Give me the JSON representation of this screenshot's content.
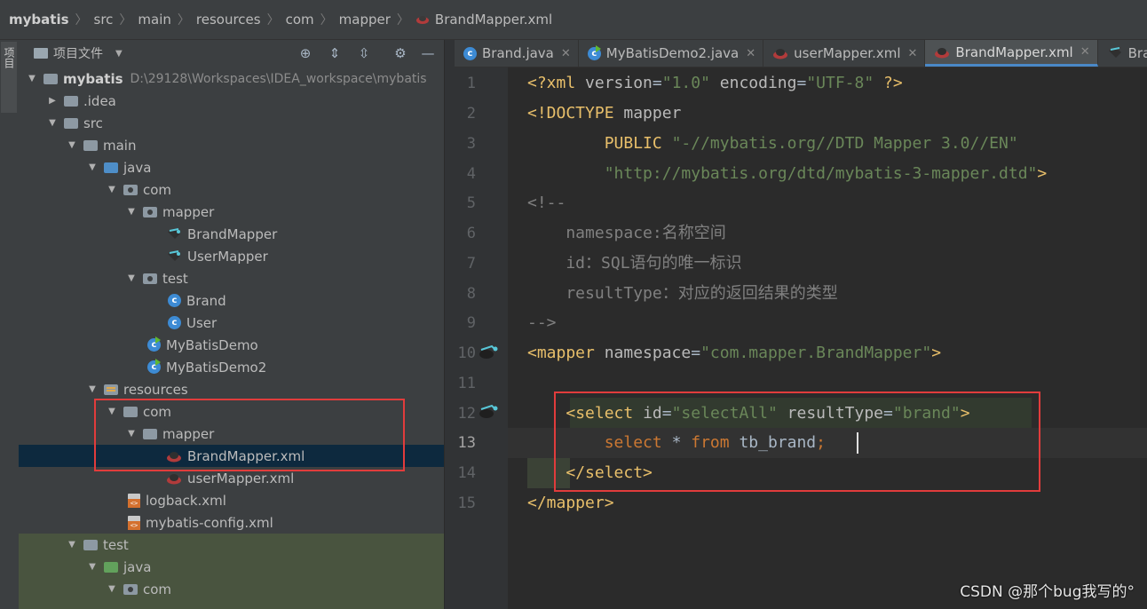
{
  "breadcrumb": [
    "mybatis",
    "src",
    "main",
    "resources",
    "com",
    "mapper",
    "BrandMapper.xml"
  ],
  "left_strip": {
    "label": "项目"
  },
  "project_panel": {
    "title": "项目文件",
    "tree": [
      {
        "label": "mybatis",
        "extra": "D:\\29128\\Workspaces\\IDEA_workspace\\mybatis",
        "icon": "module-folder-icon",
        "expanded": true
      },
      {
        "label": ".idea",
        "icon": "folder-icon",
        "expanded": false
      },
      {
        "label": "src",
        "icon": "folder-icon",
        "expanded": true
      },
      {
        "label": "main",
        "icon": "folder-icon",
        "expanded": true
      },
      {
        "label": "java",
        "icon": "source-folder-icon",
        "expanded": true
      },
      {
        "label": "com",
        "icon": "package-icon",
        "expanded": true
      },
      {
        "label": "mapper",
        "icon": "package-icon",
        "expanded": true
      },
      {
        "label": "BrandMapper",
        "icon": "mapper-interface-icon"
      },
      {
        "label": "UserMapper",
        "icon": "mapper-interface-icon"
      },
      {
        "label": "test",
        "icon": "package-icon",
        "expanded": true
      },
      {
        "label": "Brand",
        "icon": "class-icon"
      },
      {
        "label": "User",
        "icon": "class-icon"
      },
      {
        "label": "MyBatisDemo",
        "icon": "runnable-class-icon"
      },
      {
        "label": "MyBatisDemo2",
        "icon": "runnable-class-icon"
      },
      {
        "label": "resources",
        "icon": "resources-folder-icon",
        "expanded": true
      },
      {
        "label": "com",
        "icon": "folder-icon",
        "expanded": true
      },
      {
        "label": "mapper",
        "icon": "folder-icon",
        "expanded": true
      },
      {
        "label": "BrandMapper.xml",
        "icon": "mybatis-xml-icon",
        "selected": true
      },
      {
        "label": "userMapper.xml",
        "icon": "mybatis-xml-icon"
      },
      {
        "label": "logback.xml",
        "icon": "xml-file-icon"
      },
      {
        "label": "mybatis-config.xml",
        "icon": "xml-file-icon"
      },
      {
        "label": "test",
        "icon": "folder-icon",
        "expanded": true
      },
      {
        "label": "java",
        "icon": "test-source-folder-icon",
        "expanded": true
      },
      {
        "label": "com",
        "icon": "package-icon",
        "expanded": true
      }
    ]
  },
  "tabs": [
    {
      "label": "Brand.java",
      "icon": "class-icon"
    },
    {
      "label": "MyBatisDemo2.java",
      "icon": "runnable-class-icon"
    },
    {
      "label": "userMapper.xml",
      "icon": "mybatis-xml-icon"
    },
    {
      "label": "BrandMapper.xml",
      "icon": "mybatis-xml-icon",
      "active": true
    },
    {
      "label": "Bran",
      "icon": "mapper-interface-icon"
    }
  ],
  "editor": {
    "current_line": 13,
    "lines": [
      {
        "n": "1",
        "text": "<?xml version=\"1.0\" encoding=\"UTF-8\" ?>"
      },
      {
        "n": "2",
        "text": "<!DOCTYPE mapper"
      },
      {
        "n": "3",
        "text": "        PUBLIC \"-//mybatis.org//DTD Mapper 3.0//EN\""
      },
      {
        "n": "4",
        "text": "        \"http://mybatis.org/dtd/mybatis-3-mapper.dtd\">"
      },
      {
        "n": "5",
        "text": "<!--"
      },
      {
        "n": "6",
        "text": "    namespace:名称空间"
      },
      {
        "n": "7",
        "text": "    id：SQL语句的唯一标识"
      },
      {
        "n": "8",
        "text": "    resultType：对应的返回结果的类型"
      },
      {
        "n": "9",
        "text": "-->"
      },
      {
        "n": "10",
        "text": "<mapper namespace=\"com.mapper.BrandMapper\">"
      },
      {
        "n": "11",
        "text": ""
      },
      {
        "n": "12",
        "text": "    <select id=\"selectAll\" resultType=\"brand\">"
      },
      {
        "n": "13",
        "text": "        select * from tb_brand;"
      },
      {
        "n": "14",
        "text": "    </select>"
      },
      {
        "n": "15",
        "text": "</mapper>"
      }
    ]
  },
  "watermark": "CSDN @那个bug我写的°",
  "colors": {
    "highlight_box": "#e13c3c",
    "selection": "#0d293e",
    "tag": "#e8bf6a",
    "string": "#6a8759",
    "keyword": "#cc7832",
    "comment": "#808080"
  }
}
